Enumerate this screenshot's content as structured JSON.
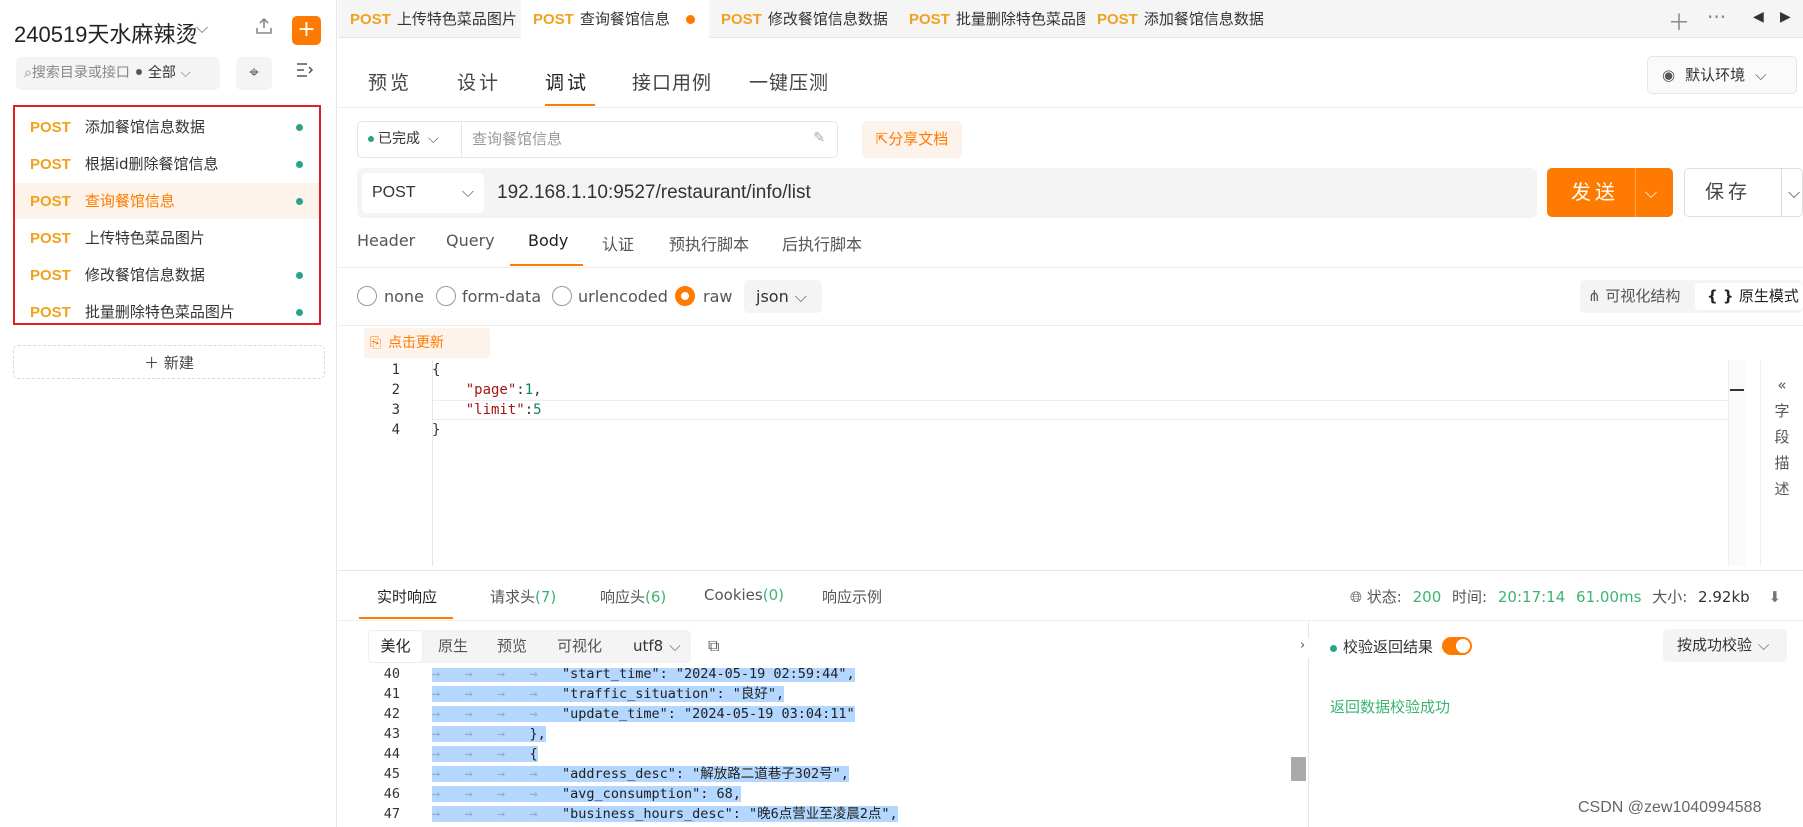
{
  "sidebar": {
    "project_name": "240519天水麻辣烫",
    "search_placeholder": "搜索目录或接口",
    "filter_label": "全部",
    "new_label": "新建",
    "items": [
      {
        "method": "POST",
        "name": "添加餐馆信息数据",
        "dot": true
      },
      {
        "method": "POST",
        "name": "根据id删除餐馆信息",
        "dot": true
      },
      {
        "method": "POST",
        "name": "查询餐馆信息",
        "dot": true,
        "active": true
      },
      {
        "method": "POST",
        "name": "上传特色菜品图片",
        "dot": false
      },
      {
        "method": "POST",
        "name": "修改餐馆信息数据",
        "dot": true
      },
      {
        "method": "POST",
        "name": "批量删除特色菜品图片",
        "dot": true
      }
    ]
  },
  "tabs": [
    {
      "method": "POST",
      "name": "上传特色菜品图片"
    },
    {
      "method": "POST",
      "name": "查询餐馆信息",
      "active": true
    },
    {
      "method": "POST",
      "name": "修改餐馆信息数据"
    },
    {
      "method": "POST",
      "name": "批量删除特色菜品图片"
    },
    {
      "method": "POST",
      "name": "添加餐馆信息数据"
    }
  ],
  "modes": [
    "预览",
    "设计",
    "调试",
    "接口用例",
    "一键压测"
  ],
  "environment": "默认环境",
  "request": {
    "status": "已完成",
    "name_placeholder": "查询餐馆信息",
    "share_label": "分享文档",
    "method": "POST",
    "url": "192.168.1.10:9527/restaurant/info/list",
    "send_label": "发送",
    "save_label": "保存",
    "tabs": [
      "Header",
      "Query",
      "Body",
      "认证",
      "预执行脚本",
      "后执行脚本"
    ],
    "body_types": [
      "none",
      "form-data",
      "urlencoded",
      "raw"
    ],
    "body_format": "json",
    "visual_label": "可视化结构",
    "raw_label": "原生模式",
    "refresh_label": "点击更新",
    "field_desc_label": "字段描述",
    "body_lines": [
      "1",
      "2",
      "3",
      "4"
    ]
  },
  "response": {
    "tabs": [
      {
        "label": "实时响应",
        "count": ""
      },
      {
        "label": "请求头",
        "count": "(7)"
      },
      {
        "label": "响应头",
        "count": "(6)"
      },
      {
        "label": "Cookies",
        "count": "(0)"
      },
      {
        "label": "响应示例",
        "count": ""
      }
    ],
    "status_label": "状态:",
    "status": "200",
    "time_label": "时间:",
    "time": "20:17:14",
    "duration": "61.00ms",
    "size_label": "大小:",
    "size": "2.92kb",
    "view_modes": [
      "美化",
      "原生",
      "预览",
      "可视化"
    ],
    "encoding": "utf8",
    "validate_label": "校验返回结果",
    "validate_mode": "按成功校验",
    "validate_result": "返回数据校验成功",
    "line_numbers": [
      "40",
      "41",
      "42",
      "43",
      "44",
      "45",
      "46",
      "47"
    ]
  },
  "watermark": "CSDN @zew1040994588",
  "colors": {
    "accent": "#ff7a00",
    "method": "#f0a21e",
    "success": "#3cb371",
    "highlight": "#e02020"
  }
}
